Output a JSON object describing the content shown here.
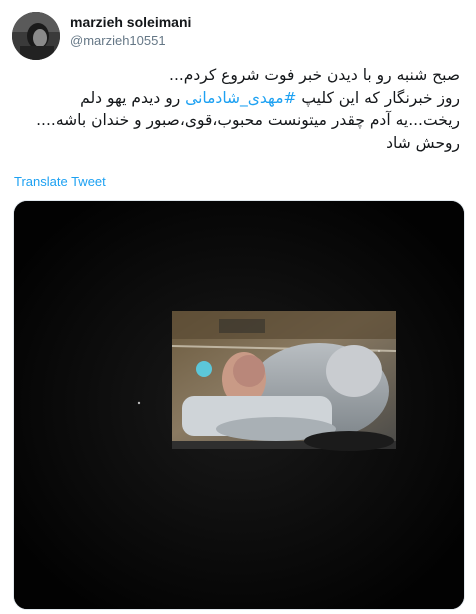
{
  "tweet": {
    "author": {
      "display_name": "marzieh soleimani",
      "handle": "@marzieh10551",
      "avatar_icon": "avatar-photo"
    },
    "text": {
      "line1": "صبح شنبه رو با دیدن خبر فوت شروع کردم...",
      "line2_before": "روز خبرنگار که این کلیپ ",
      "line2_hashtag": "#مهدی_شادمانی",
      "line2_after": " رو دیدم یهو دلم",
      "line3": "ریخت...یه آدم چقدر میتونست محبوب،قوی،صبور و خندان باشه....",
      "line4": "روحش شاد"
    },
    "translate_label": "Translate Tweet",
    "media": {
      "type": "photo",
      "description_icon": "hospital-bed-photo"
    },
    "colors": {
      "link": "#1da1f2",
      "text": "#14171a",
      "secondary": "#657786"
    }
  }
}
